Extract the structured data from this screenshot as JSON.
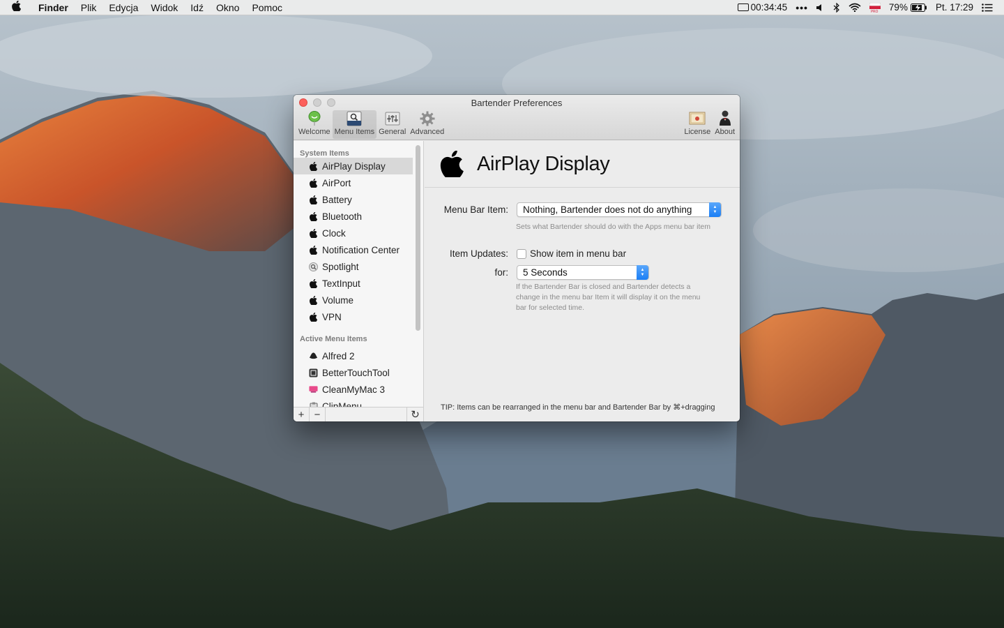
{
  "menubar": {
    "app": "Finder",
    "items": [
      "Plik",
      "Edycja",
      "Widok",
      "Idź",
      "Okno",
      "Pomoc"
    ],
    "timer": "00:34:45",
    "battery_percent": "79%",
    "clock": "Pt. 17:29"
  },
  "window": {
    "title": "Bartender Preferences",
    "toolbar": {
      "welcome": "Welcome",
      "menu_items": "Menu Items",
      "general": "General",
      "advanced": "Advanced",
      "license": "License",
      "about": "About"
    },
    "sidebar": {
      "system_header": "System Items",
      "system_items": [
        "AirPlay Display",
        "AirPort",
        "Battery",
        "Bluetooth",
        "Clock",
        "Notification Center",
        "Spotlight",
        "TextInput",
        "Volume",
        "VPN"
      ],
      "active_header": "Active Menu Items",
      "active_items": [
        "Alfred 2",
        "BetterTouchTool",
        "CleanMyMac 3",
        "ClipMenu"
      ],
      "add_label": "+",
      "remove_label": "−",
      "refresh_label": "↻"
    },
    "content": {
      "title": "AirPlay Display",
      "menu_bar_item_label": "Menu Bar Item:",
      "menu_bar_item_value": "Nothing, Bartender does not do anything",
      "menu_bar_item_hint": "Sets what Bartender should do with the Apps menu bar item",
      "item_updates_label": "Item Updates:",
      "show_in_menu_bar_label": "Show item in menu bar",
      "show_in_menu_bar_checked": false,
      "for_label": "for:",
      "for_value": "5 Seconds",
      "for_hint_1": "If the Bartender Bar is closed and Bartender detects a",
      "for_hint_2": "change in the menu bar Item it will display it on the menu",
      "for_hint_3": "bar for selected time.",
      "tip": "TIP: Items can be rearranged in the menu bar and Bartender Bar by ⌘+dragging"
    }
  }
}
